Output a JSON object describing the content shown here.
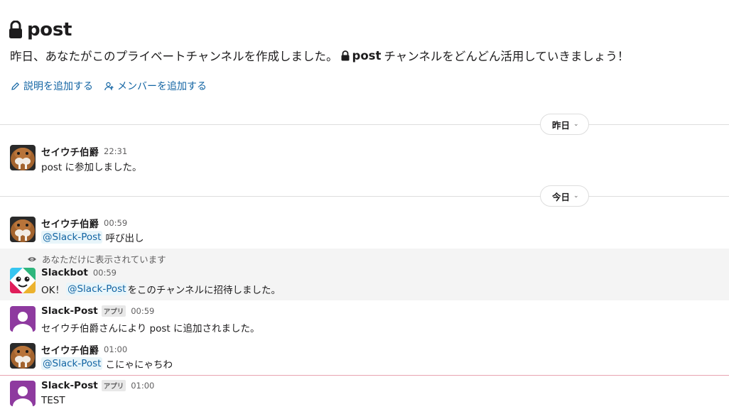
{
  "channel": {
    "name": "post",
    "intro_before": "昨日、あなたがこのプライベートチャンネルを作成しました。",
    "intro_channel": "post",
    "intro_after": "チャンネルをどんどん活用していきましょう！",
    "actions": {
      "add_description": "説明を追加する",
      "add_members": "メンバーを追加する"
    }
  },
  "dividers": {
    "yesterday": "昨日",
    "today": "今日",
    "chevron": "⌄"
  },
  "ephemeral_note": "あなただけに表示されています",
  "app_badge": "アプリ",
  "messages": [
    {
      "author": "セイウチ伯爵",
      "time": "22:31",
      "text": "post に参加しました。"
    },
    {
      "author": "セイウチ伯爵",
      "time": "00:59",
      "mention": "@Slack-Post",
      "text": "呼び出し"
    },
    {
      "author": "Slackbot",
      "time": "00:59",
      "prefix": "OK！",
      "mention": "@Slack-Post",
      "text": "をこのチャンネルに招待しました。"
    },
    {
      "author": "Slack-Post",
      "time": "00:59",
      "text": "セイウチ伯爵さんにより post に追加されました。"
    },
    {
      "author": "セイウチ伯爵",
      "time": "01:00",
      "mention": "@Slack-Post",
      "text": "こにゃにゃちわ"
    },
    {
      "author": "Slack-Post",
      "time": "01:00",
      "text": "TEST"
    }
  ],
  "colors": {
    "link": "#1264a3",
    "mention_bg": "#e8f5fa",
    "app_avatar": "#8e3a9f",
    "new_message_line": "#e8a3b0"
  }
}
